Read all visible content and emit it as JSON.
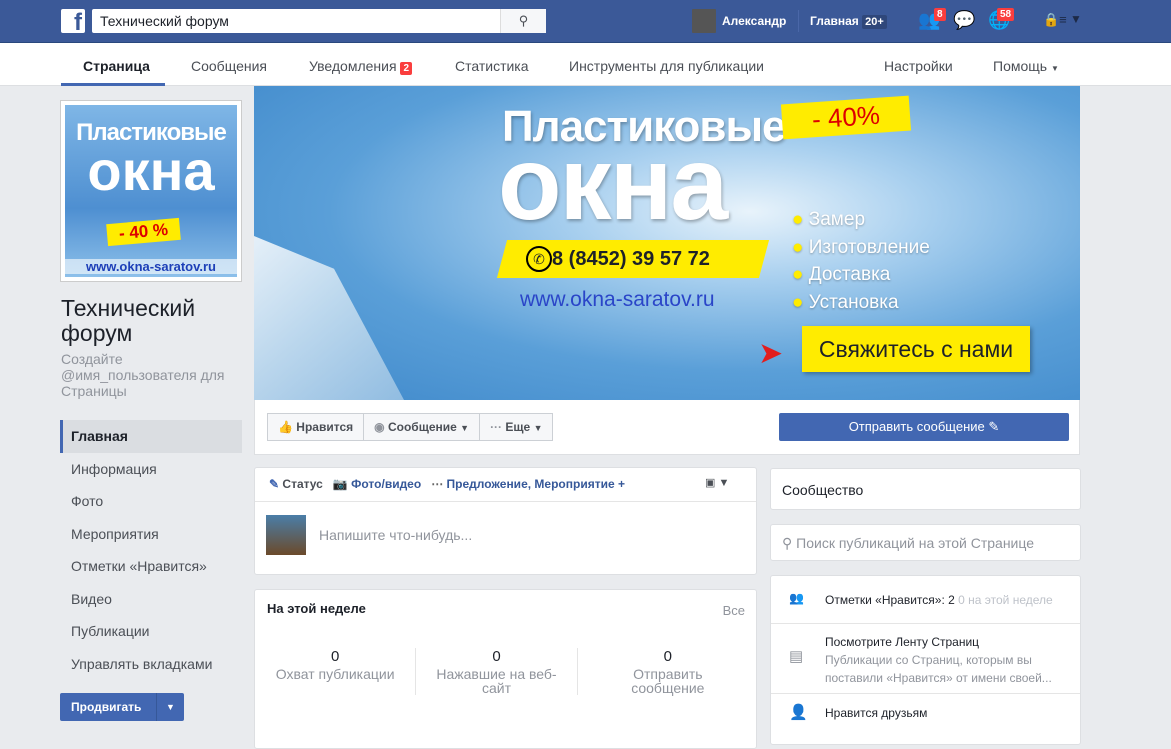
{
  "topbar": {
    "search_value": "Технический форум",
    "user_name": "Александр",
    "home_label": "Главная",
    "home_count": "20+",
    "friend_requests": "8",
    "notifications": "58"
  },
  "subnav": {
    "items": [
      "Страница",
      "Сообщения",
      "Уведомления",
      "Статистика",
      "Инструменты для публикации",
      "Настройки",
      "Помощь"
    ],
    "notifications_badge": "2"
  },
  "profile_pic": {
    "line1": "Пластиковые",
    "line2": "окна",
    "discount": "- 40 %",
    "url": "www.okna-saratov.ru"
  },
  "page": {
    "title": "Технический форум",
    "username_hint": "Создайте @имя_пользователя для Страницы"
  },
  "sidebar": {
    "items": [
      "Главная",
      "Информация",
      "Фото",
      "Мероприятия",
      "Отметки «Нравится»",
      "Видео",
      "Публикации",
      "Управлять вкладками"
    ],
    "promote": "Продвигать"
  },
  "cover": {
    "line1": "Пластиковые",
    "line2": "окна",
    "discount": "- 40%",
    "phone": "8 (8452) 39 57 72",
    "url": "www.okna-saratov.ru",
    "services": [
      "Замер",
      "Изготовление",
      "Доставка",
      "Установка"
    ],
    "cta": "Свяжитесь с нами"
  },
  "actions": {
    "like": "Нравится",
    "message": "Сообщение",
    "more": "Еще",
    "send_message": "Отправить сообщение"
  },
  "composer": {
    "status": "Статус",
    "photo": "Фото/видео",
    "offer": "Предложение, Мероприятие +",
    "placeholder": "Напишите что-нибудь..."
  },
  "week": {
    "title": "На этой неделе",
    "all": "Все",
    "stats": [
      {
        "value": "0",
        "label": "Охват публикации"
      },
      {
        "value": "0",
        "label": "Нажавшие на веб-сайт"
      },
      {
        "value": "0",
        "label": "Отправить сообщение"
      }
    ]
  },
  "right": {
    "community": "Сообщество",
    "search_placeholder": "Поиск публикаций на этой Странице",
    "likes_label": "Отметки «Нравится»: 2",
    "likes_week": "0 на этой неделе",
    "feed_title": "Посмотрите Ленту Страниц",
    "feed_desc": "Публикации со Страниц, которым вы поставили «Нравится» от имени своей...",
    "friends_like": "Нравится друзьям"
  }
}
